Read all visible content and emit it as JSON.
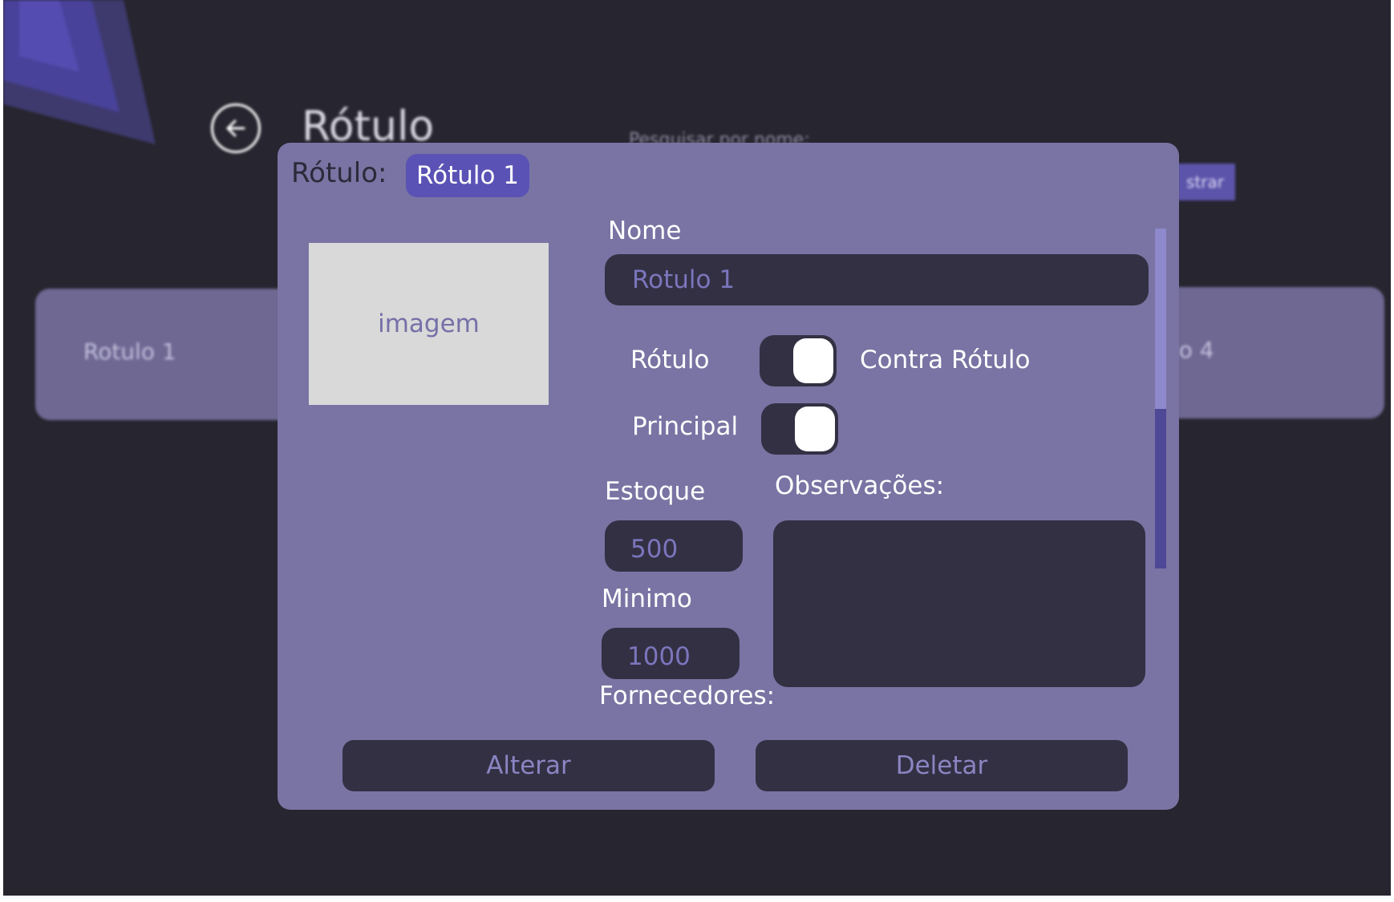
{
  "background_page": {
    "title": "Rótulo",
    "search_label": "Pesquisar por nome:",
    "register_button": "strar",
    "cards": [
      "Rotulo 1",
      "lo 4"
    ]
  },
  "modal": {
    "header_label": "Rótulo:",
    "selected_label": "Rótulo 1",
    "image_placeholder": "imagem",
    "name": {
      "label": "Nome",
      "value": "Rotulo 1"
    },
    "type_toggle": {
      "left_label": "Rótulo",
      "right_label": "Contra Rótulo"
    },
    "principal": {
      "label": "Principal"
    },
    "stock": {
      "label": "Estoque",
      "value": "500"
    },
    "minimum": {
      "label": "Minimo",
      "value": "1000"
    },
    "notes": {
      "label": "Observações:",
      "value": ""
    },
    "suppliers_label": "Fornecedores:",
    "buttons": {
      "alter": "Alterar",
      "delete": "Deletar"
    }
  },
  "colors": {
    "background": "#27252f",
    "modal": "#7974a3",
    "accent": "#5a52b5",
    "field": "#333044"
  },
  "icons": {
    "back": "arrow-left-icon"
  }
}
